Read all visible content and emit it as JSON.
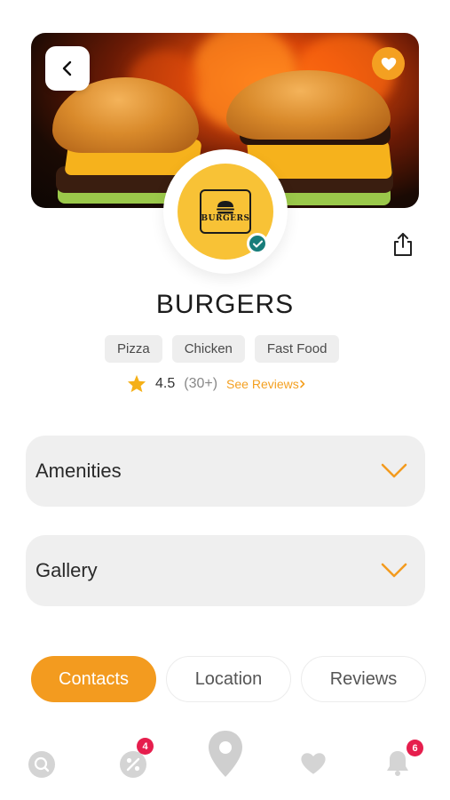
{
  "restaurant": {
    "name": "BURGERS",
    "tags": [
      "Pizza",
      "Chicken",
      "Fast Food"
    ],
    "rating": "4.5",
    "review_count": "(30+)",
    "see_reviews": "See Reviews",
    "logo_text": "BURGERS"
  },
  "sections": {
    "amenities": "Amenities",
    "gallery": "Gallery"
  },
  "tabs": [
    "Contacts",
    "Location",
    "Reviews"
  ],
  "nav": {
    "offers_badge": "4",
    "notifications_badge": "6"
  },
  "colors": {
    "accent": "#f39b1f",
    "verified": "#177d7a",
    "badge": "#e61e4d"
  }
}
